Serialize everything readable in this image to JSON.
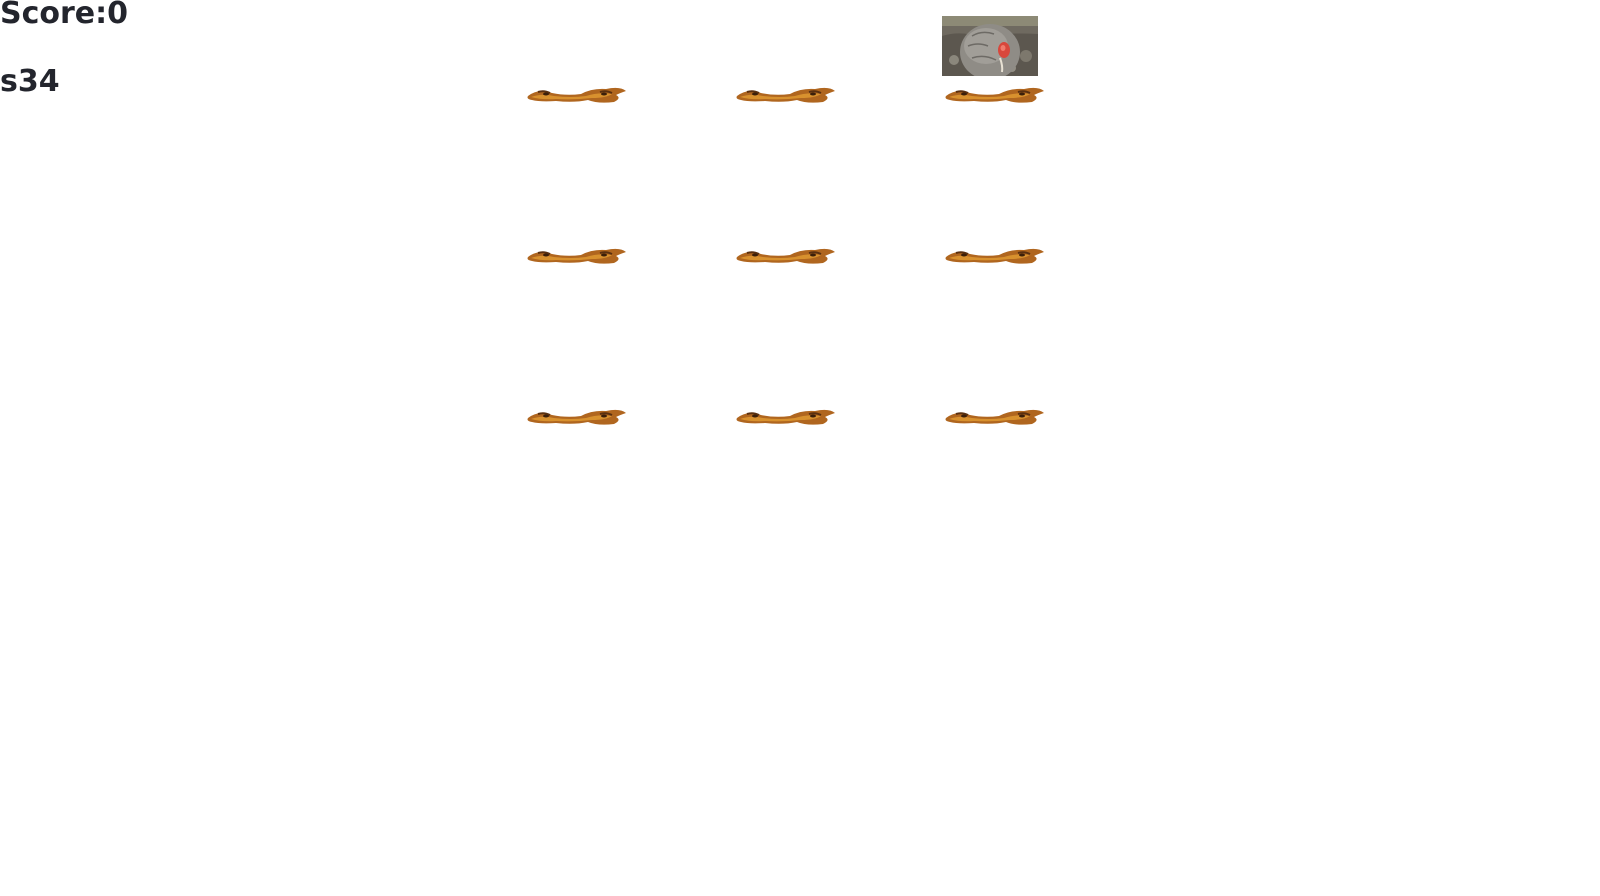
{
  "hud": {
    "score_text": "Score:0",
    "timer_text": "s34"
  },
  "board": {
    "rows": 3,
    "cols": 3,
    "holes": [
      {
        "row": 1,
        "col": 1,
        "mole_visible": false
      },
      {
        "row": 1,
        "col": 2,
        "mole_visible": false
      },
      {
        "row": 1,
        "col": 3,
        "mole_visible": true
      },
      {
        "row": 2,
        "col": 1,
        "mole_visible": false
      },
      {
        "row": 2,
        "col": 2,
        "mole_visible": false
      },
      {
        "row": 2,
        "col": 3,
        "mole_visible": false
      },
      {
        "row": 3,
        "col": 1,
        "mole_visible": false
      },
      {
        "row": 3,
        "col": 2,
        "mole_visible": false
      },
      {
        "row": 3,
        "col": 3,
        "mole_visible": false
      }
    ]
  },
  "colors": {
    "text": "#23252d",
    "dirt_dark": "#7a4414",
    "dirt_mid": "#b0661f",
    "dirt_light": "#d8912e",
    "mole_fur": "#8f8c86",
    "mole_nose": "#d8473c",
    "ground_bg": "#6f6a60"
  },
  "icons": {
    "hole": "dirt-mound-icon",
    "mole": "mole-icon"
  }
}
